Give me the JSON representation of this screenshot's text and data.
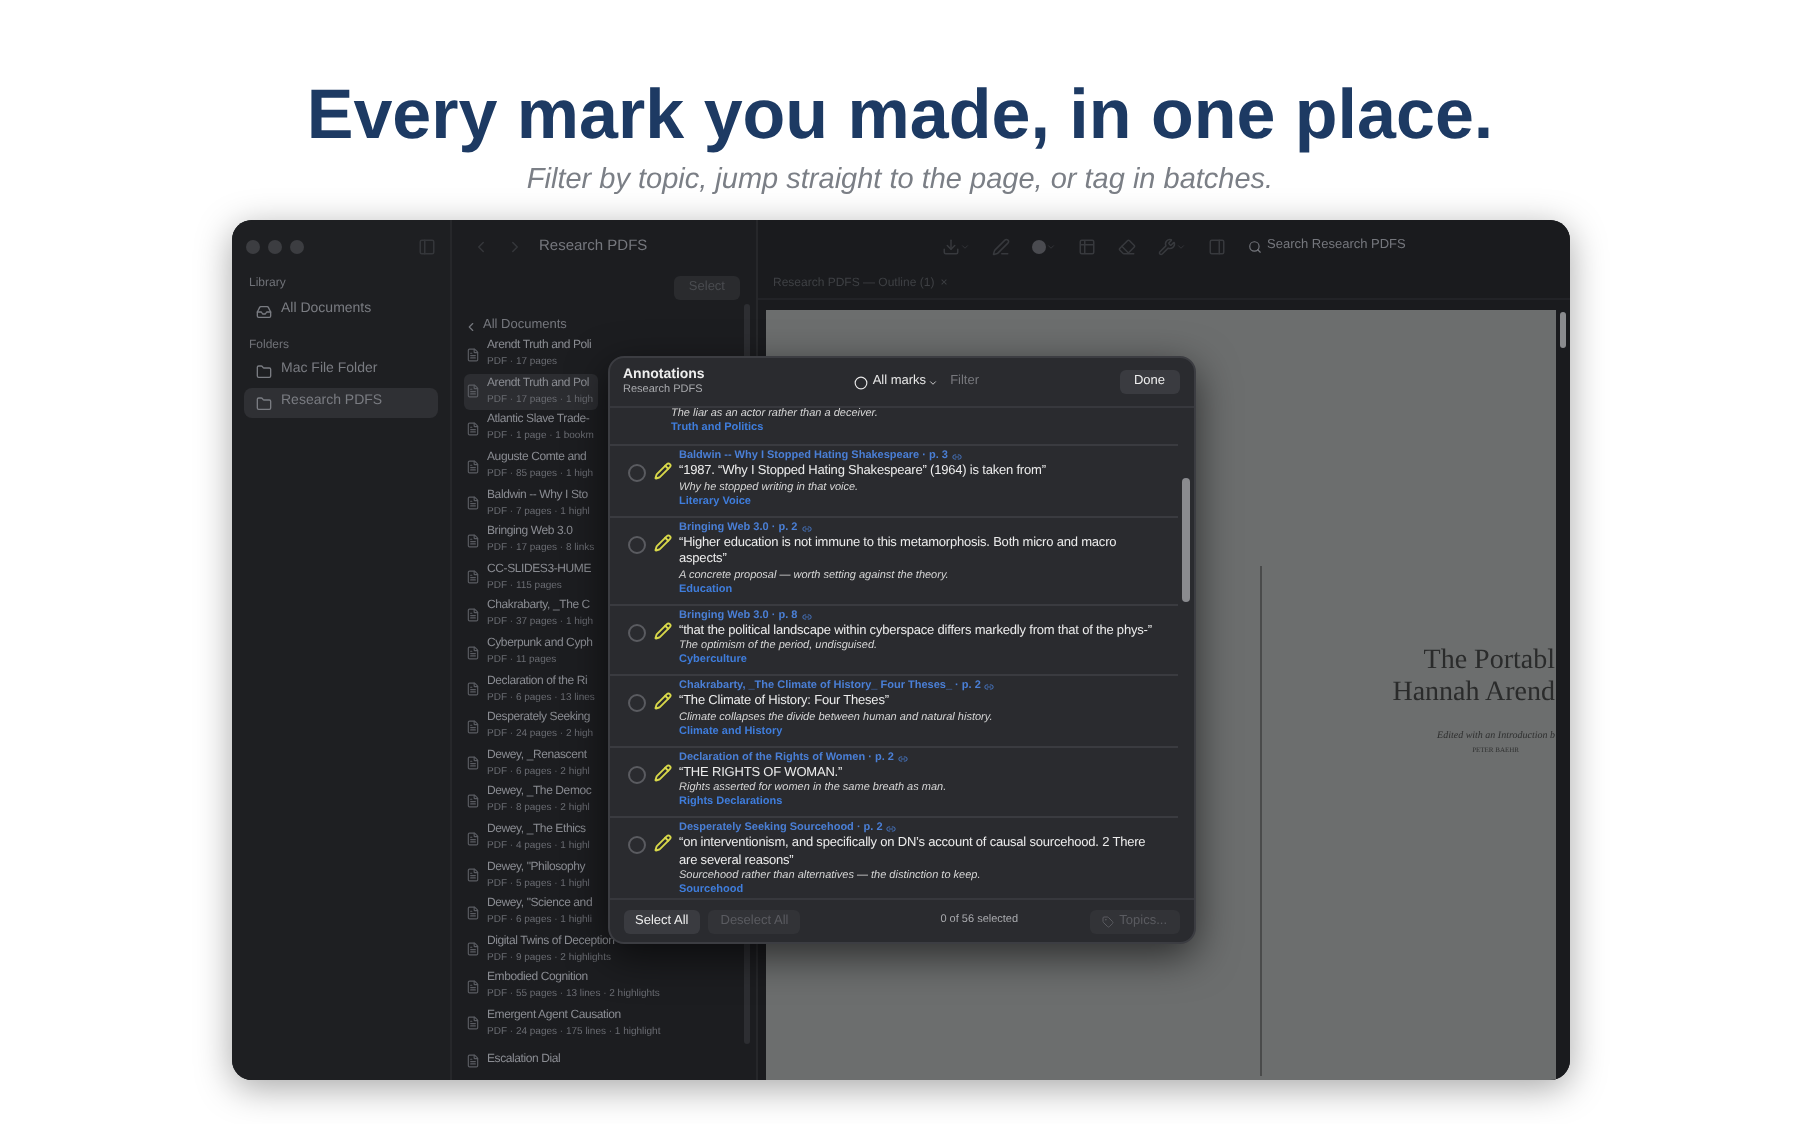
{
  "headline": "Every mark you made, in one place.",
  "subtitle": "Filter by topic, jump straight to the page, or tag in batches.",
  "sidebar": {
    "library_heading": "Library",
    "library_items": [
      {
        "label": "All Documents",
        "selected": false
      }
    ],
    "folders_heading": "Folders",
    "folders": [
      {
        "label": "Mac File Folder",
        "selected": false
      },
      {
        "label": "Research PDFS",
        "selected": true
      }
    ]
  },
  "toolbar": {
    "title": "Research PDFS",
    "search_placeholder": "Search Research PDFS"
  },
  "document_list": {
    "select_button": "Select",
    "back_label": "All Documents",
    "items": [
      {
        "title": "Arendt Truth and Poli",
        "meta": "PDF · 17 pages",
        "selected": false
      },
      {
        "title": "Arendt Truth and Pol",
        "meta": "PDF · 17 pages · 1 high",
        "selected": true
      },
      {
        "title": "Atlantic Slave Trade-",
        "meta": "PDF · 1 page · 1 bookm",
        "selected": false
      },
      {
        "title": "Auguste Comte and",
        "meta": "PDF · 85 pages · 1 high",
        "selected": false
      },
      {
        "title": "Baldwin -- Why I Sto",
        "meta": "PDF · 7 pages · 1 highl",
        "selected": false
      },
      {
        "title": "Bringing Web 3.0",
        "meta": "PDF · 17 pages · 8 links",
        "selected": false
      },
      {
        "title": "CC-SLIDES3-HUME",
        "meta": "PDF · 115 pages",
        "selected": false
      },
      {
        "title": "Chakrabarty, _The C",
        "meta": "PDF · 37 pages · 1 high",
        "selected": false
      },
      {
        "title": "Cyberpunk and Cyph",
        "meta": "PDF · 11 pages",
        "selected": false
      },
      {
        "title": "Declaration of the Ri",
        "meta": "PDF · 6 pages · 13 lines",
        "selected": false
      },
      {
        "title": "Desperately Seeking",
        "meta": "PDF · 24 pages · 2 high",
        "selected": false
      },
      {
        "title": "Dewey, _Renascent",
        "meta": "PDF · 6 pages · 2 highl",
        "selected": false
      },
      {
        "title": "Dewey, _The Democ",
        "meta": "PDF · 8 pages · 2 highl",
        "selected": false
      },
      {
        "title": "Dewey, _The Ethics",
        "meta": "PDF · 4 pages · 1 highl",
        "selected": false
      },
      {
        "title": "Dewey, \"Philosophy",
        "meta": "PDF · 5 pages · 1 highl",
        "selected": false
      },
      {
        "title": "Dewey, \"Science and",
        "meta": "PDF · 6 pages · 1 highli",
        "selected": false
      },
      {
        "title": "Digital Twins of Deception",
        "meta": "PDF · 9 pages · 2 highlights",
        "selected": false
      },
      {
        "title": "Embodied Cognition",
        "meta": "PDF · 55 pages · 13 lines · 2 highlights",
        "selected": false
      },
      {
        "title": "Emergent Agent Causation",
        "meta": "PDF · 24 pages · 175 lines · 1 highlight",
        "selected": false
      },
      {
        "title": "Escalation Dial",
        "selected": false
      }
    ]
  },
  "document_tab": {
    "label": "Research PDFS — Outline (1)",
    "close": "×"
  },
  "page": {
    "title_lines": [
      "The Portabl",
      "Hannah Arend"
    ],
    "editor_line": "Edited with an Introduction b",
    "editor_name": "PETER BAEHR"
  },
  "annotations": {
    "title": "Annotations",
    "subtitle": "Research PDFS",
    "filter_menu": "All marks",
    "filter_placeholder": "Filter",
    "done": "Done",
    "entries": [
      {
        "kind": "continued",
        "note": "The liar as an actor rather than a deceiver.",
        "tag": "Truth and Politics"
      },
      {
        "kind": "full",
        "selected": false,
        "source": "Baldwin -- Why I Stopped Hating Shakespeare · p. 3",
        "quote": "“1987. “Why I Stopped Hating Shakespeare” (1964) is taken from”",
        "note": "Why he stopped writing in that voice.",
        "tag": "Literary Voice"
      },
      {
        "kind": "full",
        "selected": false,
        "source": "Bringing Web 3.0 · p. 2",
        "quote": "“Higher education is not immune to this metamorphosis. Both micro and macro aspects”",
        "note": "A concrete proposal — worth setting against the theory.",
        "tag": "Education"
      },
      {
        "kind": "full",
        "selected": false,
        "source": "Bringing Web 3.0 · p. 8",
        "quote": "“that the political landscape within cyberspace differs markedly from that of the phys-”",
        "note": "The optimism of the period, undisguised.",
        "tag": "Cyberculture"
      },
      {
        "kind": "full",
        "selected": false,
        "source": "Chakrabarty, _The Climate of History_ Four Theses_ · p. 2",
        "quote": "“The Climate of History: Four Theses”",
        "note": "Climate collapses the divide between human and natural history.",
        "tag": "Climate and History"
      },
      {
        "kind": "full",
        "selected": false,
        "source": "Declaration of the Rights of Women · p. 2",
        "quote": "“THE RIGHTS OF WOMAN.”",
        "note": "Rights asserted for women in the same breath as man.",
        "tag": "Rights Declarations"
      },
      {
        "kind": "full",
        "selected": false,
        "source": "Desperately Seeking Sourcehood · p. 2",
        "quote": "“on interventionism, and specifically on DN’s account of causal sourcehood. 2 There are several reasons”",
        "note": "Sourcehood rather than alternatives — the distinction to keep.",
        "tag": "Sourcehood"
      }
    ],
    "select_all": {
      "label": "Select All",
      "disabled": false
    },
    "deselect_all": {
      "label": "Deselect All",
      "disabled": true
    },
    "count": "0 of 56 selected",
    "topics": {
      "label": "Topics...",
      "disabled": true
    }
  }
}
